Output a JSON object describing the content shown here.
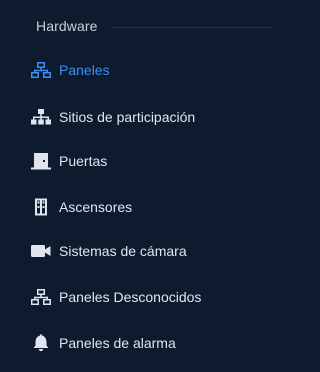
{
  "section": {
    "title": "Hardware"
  },
  "colors": {
    "background": "#0e1b2e",
    "text": "#dfe5ee",
    "active": "#3a8ef6",
    "divider": "#26344a"
  },
  "items": [
    {
      "label": "Paneles",
      "icon": "network-icon",
      "active": true
    },
    {
      "label": "Sitios de participación",
      "icon": "sitemap-icon",
      "active": false
    },
    {
      "label": "Puertas",
      "icon": "door-icon",
      "active": false
    },
    {
      "label": "Ascensores",
      "icon": "elevator-icon",
      "active": false
    },
    {
      "label": "Sistemas de cámara",
      "icon": "camera-icon",
      "active": false
    },
    {
      "label": "Paneles Desconocidos",
      "icon": "network-icon",
      "active": false
    },
    {
      "label": "Paneles de alarma",
      "icon": "bell-icon",
      "active": false
    }
  ]
}
